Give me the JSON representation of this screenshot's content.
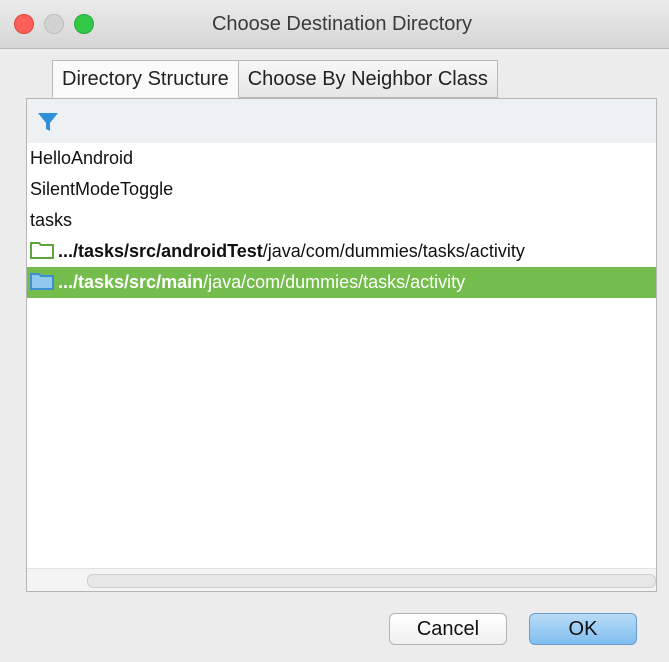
{
  "window": {
    "title": "Choose Destination Directory"
  },
  "tabs": [
    {
      "label": "Directory Structure",
      "active": true
    },
    {
      "label": "Choose By Neighbor Class",
      "active": false
    }
  ],
  "toolbar": {
    "filter_icon": "filter-icon",
    "accent_color": "#2f8fd8"
  },
  "tree": {
    "items": [
      {
        "label": "HelloAndroid"
      },
      {
        "label": "SilentModeToggle"
      },
      {
        "label": "tasks"
      },
      {
        "prefix": ".../tasks/src/androidTest",
        "suffix": "/java/com/dummies/tasks/activity",
        "icon": "folder-icon",
        "selected": false
      },
      {
        "prefix": ".../tasks/src/main",
        "suffix": "/java/com/dummies/tasks/activity",
        "icon": "folder-icon",
        "selected": true
      }
    ],
    "selection_color": "#74bd4d"
  },
  "buttons": {
    "cancel_label": "Cancel",
    "ok_label": "OK"
  }
}
